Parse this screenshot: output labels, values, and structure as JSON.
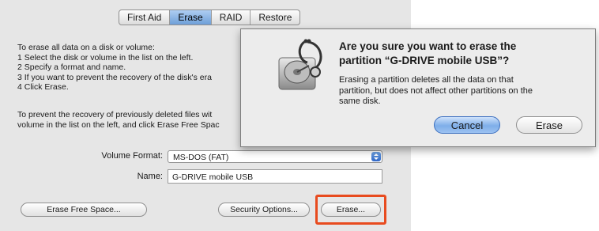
{
  "tabs": [
    {
      "label": "First Aid",
      "active": false
    },
    {
      "label": "Erase",
      "active": true
    },
    {
      "label": "RAID",
      "active": false
    },
    {
      "label": "Restore",
      "active": false
    }
  ],
  "instructions": {
    "block1": "To erase all data on a disk or volume:\n1 Select the disk or volume in the list on the left.\n2 Specify a format and name.\n3 If you want to prevent the recovery of the disk's era\n4 Click Erase.",
    "block2": "To prevent the recovery of previously deleted files wit\nvolume in the list on the left, and click Erase Free Spac"
  },
  "form": {
    "volume_format_label": "Volume Format:",
    "volume_format_value": "MS-DOS (FAT)",
    "name_label": "Name:",
    "name_value": "G-DRIVE mobile USB"
  },
  "buttons": {
    "erase_free_space": "Erase Free Space...",
    "security_options": "Security Options...",
    "erase": "Erase..."
  },
  "dialog": {
    "title": "Are you sure you want to erase the\npartition “G-DRIVE mobile USB”?",
    "message": "Erasing a partition deletes all the data on that\npartition, but does not affect other partitions on the\nsame disk.",
    "cancel_label": "Cancel",
    "erase_label": "Erase"
  },
  "colors": {
    "highlight": "#e84b1f",
    "default_button": "#7eaee9"
  },
  "icons": {
    "dialog_icon": "disk-utility-stethoscope-icon",
    "select_arrow": "updown-arrows-icon"
  }
}
